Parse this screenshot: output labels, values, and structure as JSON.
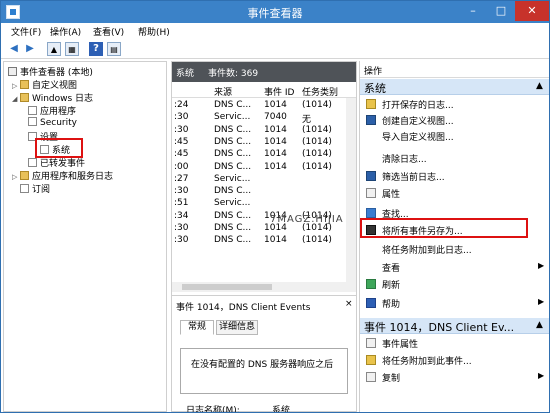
{
  "window": {
    "title": "事件查看器",
    "controls": {
      "minimize": "–",
      "maximize": "□",
      "close": "✕"
    }
  },
  "menu": [
    "文件(F)",
    "操作(A)",
    "查看(V)",
    "帮助(H)"
  ],
  "toolbar": {
    "back": "◀",
    "forward": "▶"
  },
  "tree": {
    "root": "事件查看器 (本地)",
    "items": [
      "自定义视图",
      "Windows 日志",
      "应用程序",
      "Security",
      "设置",
      "系统",
      "已转发事件",
      "应用程序和服务日志",
      "订阅"
    ]
  },
  "events": {
    "header_name": "系统",
    "header_count": "事件数: 369",
    "columns": [
      "来源",
      "事件 ID",
      "任务类别"
    ],
    "rows": [
      [
        ":24",
        "DNS C...",
        "1014",
        "(1014)"
      ],
      [
        ":30",
        "Servic...",
        "7040",
        "无"
      ],
      [
        ":30",
        "DNS C...",
        "1014",
        "(1014)"
      ],
      [
        ":45",
        "DNS C...",
        "1014",
        "(1014)"
      ],
      [
        ":45",
        "DNS C...",
        "1014",
        "(1014)"
      ],
      [
        ":00",
        "DNS C...",
        "1014",
        "(1014)"
      ],
      [
        ":27",
        "Servic...",
        "",
        ""
      ],
      [
        ":30",
        "DNS C...",
        "",
        ""
      ],
      [
        ":51",
        "Servic...",
        "",
        ""
      ],
      [
        ":34",
        "DNS C...",
        "1014",
        "(1014)"
      ],
      [
        ":30",
        "DNS C...",
        "1014",
        "(1014)"
      ],
      [
        ":30",
        "DNS C...",
        "1014",
        "(1014)"
      ]
    ],
    "watermark": "7MAGZ.HIJIA"
  },
  "detail": {
    "title": "事件 1014，DNS Client Events",
    "close": "×",
    "tabs": [
      "常规",
      "详细信息"
    ],
    "message": "在没有配置的 DNS 服务器响应之后",
    "log_label": "日志名称(M):",
    "log_value": "系统"
  },
  "actions": {
    "header": "操作",
    "section1": "系统",
    "items1": [
      "打开保存的日志...",
      "创建自定义视图...",
      "导入自定义视图...",
      "清除日志...",
      "筛选当前日志...",
      "属性",
      "查找...",
      "将所有事件另存为...",
      "将任务附加到此日志...",
      "查看",
      "刷新",
      "帮助"
    ],
    "section2": "事件 1014，DNS Client Ev...",
    "items2": [
      "事件属性",
      "将任务附加到此事件...",
      "复制"
    ]
  }
}
